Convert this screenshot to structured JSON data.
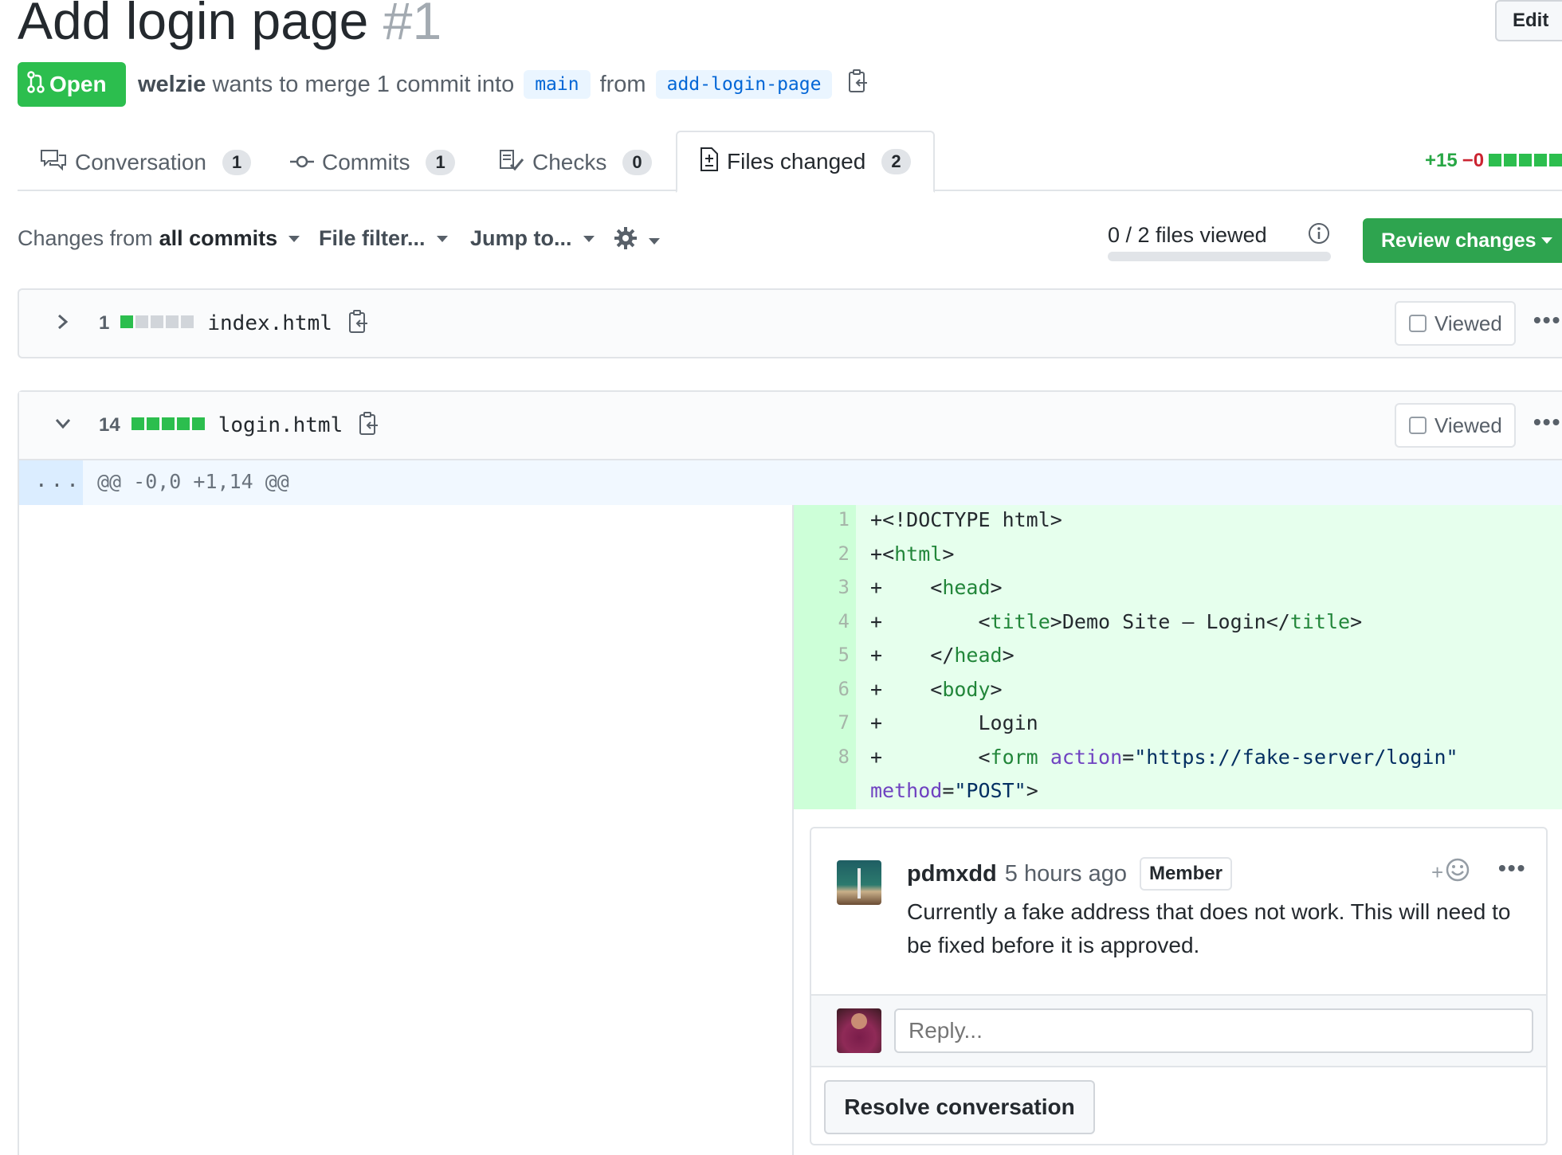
{
  "header": {
    "title": "Add login page",
    "number": "#1",
    "edit_label": "Edit",
    "state": "Open",
    "author": "welzie",
    "merge_text": "wants to merge 1 commit into",
    "base_branch": "main",
    "from_text": "from",
    "head_branch": "add-login-page"
  },
  "tabs": [
    {
      "label": "Conversation",
      "count": "1",
      "icon": "comment-discussion-icon"
    },
    {
      "label": "Commits",
      "count": "1",
      "icon": "git-commit-icon"
    },
    {
      "label": "Checks",
      "count": "0",
      "icon": "checklist-icon"
    },
    {
      "label": "Files changed",
      "count": "2",
      "icon": "file-diff-icon",
      "selected": true
    }
  ],
  "diffstat": {
    "additions": "+15",
    "deletions": "−0"
  },
  "toolbar": {
    "changes_prefix": "Changes from",
    "changes_value": "all commits",
    "file_filter": "File filter...",
    "jump_to": "Jump to...",
    "files_viewed": "0 / 2 files viewed",
    "files_viewed_fraction": 0,
    "review_changes": "Review changes"
  },
  "files": [
    {
      "lines_changed": "1",
      "name": "index.html",
      "expanded": false,
      "viewed_label": "Viewed"
    },
    {
      "lines_changed": "14",
      "name": "login.html",
      "expanded": true,
      "viewed_label": "Viewed"
    }
  ],
  "hunk": {
    "expander": "...",
    "header": "@@ -0,0 +1,14 @@"
  },
  "diff_lines": [
    {
      "num": "1",
      "prefix": "+",
      "parts": [
        [
          "p",
          "<!DOCTYPE html>"
        ]
      ]
    },
    {
      "num": "2",
      "prefix": "+",
      "parts": [
        [
          "p",
          "<"
        ],
        [
          "t",
          "html"
        ],
        [
          "p",
          ">"
        ]
      ]
    },
    {
      "num": "3",
      "prefix": "+",
      "parts": [
        [
          "p",
          "    <"
        ],
        [
          "t",
          "head"
        ],
        [
          "p",
          ">"
        ]
      ]
    },
    {
      "num": "4",
      "prefix": "+",
      "parts": [
        [
          "p",
          "        <"
        ],
        [
          "t",
          "title"
        ],
        [
          "p",
          ">Demo Site – Login</"
        ],
        [
          "t",
          "title"
        ],
        [
          "p",
          ">"
        ]
      ]
    },
    {
      "num": "5",
      "prefix": "+",
      "parts": [
        [
          "p",
          "    </"
        ],
        [
          "t",
          "head"
        ],
        [
          "p",
          ">"
        ]
      ]
    },
    {
      "num": "6",
      "prefix": "+",
      "parts": [
        [
          "p",
          "    <"
        ],
        [
          "t",
          "body"
        ],
        [
          "p",
          ">"
        ]
      ]
    },
    {
      "num": "7",
      "prefix": "+",
      "parts": [
        [
          "p",
          "        Login"
        ]
      ]
    },
    {
      "num": "8",
      "prefix": "+",
      "parts": [
        [
          "p",
          "        <"
        ],
        [
          "t",
          "form"
        ],
        [
          "p",
          " "
        ],
        [
          "a",
          "action"
        ],
        [
          "p",
          "="
        ],
        [
          "s",
          "\"https://fake-server/login\""
        ]
      ]
    },
    {
      "num": "",
      "prefix": "",
      "parts": [
        [
          "a",
          "method"
        ],
        [
          "p",
          "="
        ],
        [
          "s",
          "\"POST\""
        ],
        [
          "p",
          ">"
        ]
      ]
    }
  ],
  "comment": {
    "author": "pdmxdd",
    "time": "5 hours ago",
    "badge": "Member",
    "react": "+",
    "body": "Currently a fake address that does not work. This will need to be fixed before it is approved.",
    "reply_placeholder": "Reply...",
    "resolve_label": "Resolve conversation"
  },
  "colors": {
    "open_green": "#2cbe4e",
    "addition_bg": "#e6ffed",
    "addition_gutter": "#cdffd8",
    "link_blue": "#0366d6",
    "deletion_red": "#cb2431"
  }
}
